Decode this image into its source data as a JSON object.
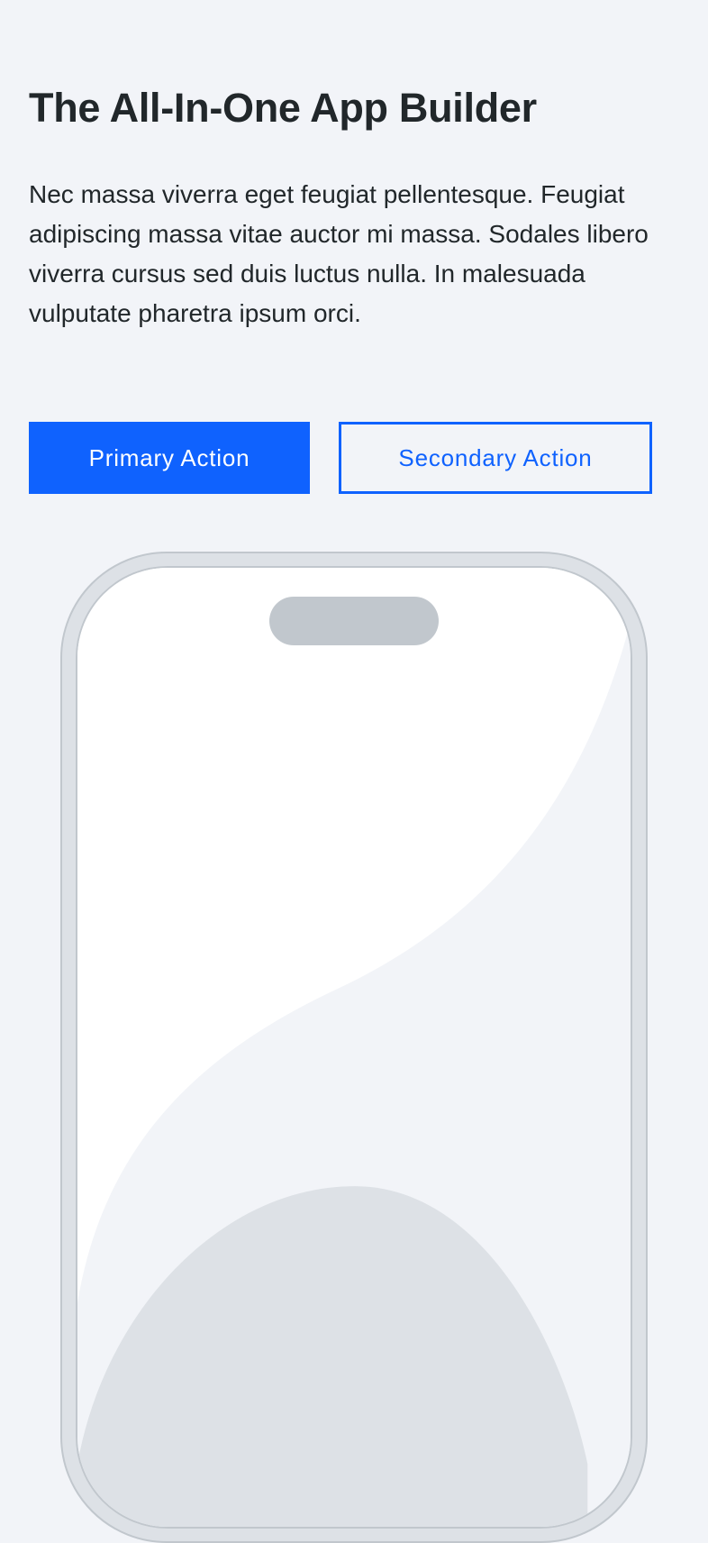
{
  "hero": {
    "title": "The All-In-One App Builder",
    "description": "Nec massa viverra eget feugiat pellentesque. Feugiat adipiscing massa vitae auctor mi massa. Sodales libero viverra cursus sed duis luctus nulla. In malesuada vulputate pharetra ipsum orci."
  },
  "actions": {
    "primary_label": "Primary Action",
    "secondary_label": "Secondary Action"
  },
  "colors": {
    "background": "#f2f4f8",
    "text": "#21272a",
    "accent": "#0f62fe",
    "phone_frame": "#dde1e6",
    "phone_border": "#c1c7cd",
    "screen_surface": "#ffffff"
  },
  "illustration": {
    "icon": "phone-mockup"
  }
}
